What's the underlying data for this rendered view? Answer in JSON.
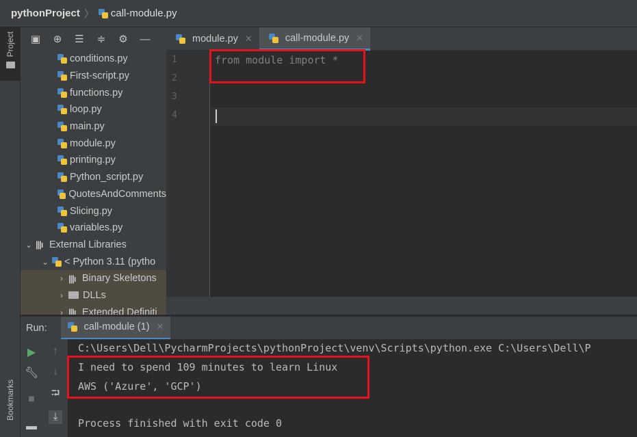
{
  "breadcrumb": {
    "project": "pythonProject",
    "separator": "〉",
    "file": "call-module.py"
  },
  "left_strip": {
    "project_label": "Project",
    "bookmarks_label": "Bookmarks"
  },
  "project_panel": {
    "toolbar_icons": [
      "layout-icon",
      "crosshair-icon",
      "collapse-all-icon",
      "expand-all-icon",
      "gear-icon",
      "minimize-icon"
    ],
    "files": [
      "conditions.py",
      "First-script.py",
      "functions.py",
      "loop.py",
      "main.py",
      "module.py",
      "printing.py",
      "Python_script.py",
      "QuotesAndComments",
      "Slicing.py",
      "variables.py"
    ],
    "external_libraries": "External Libraries",
    "python_sdk": "< Python 3.11 (pytho",
    "binary_skeletons": "Binary Skeletons",
    "dlls": "DLLs",
    "extended_definitions": "Extended Definiti"
  },
  "editor": {
    "tabs": [
      {
        "label": "module.py",
        "active": false
      },
      {
        "label": "call-module.py",
        "active": true
      }
    ],
    "line_numbers": [
      "1",
      "2",
      "3",
      "4"
    ],
    "code_line_1": "from module import *"
  },
  "run": {
    "label": "Run:",
    "tab_label": "call-module (1)",
    "console_command": "C:\\Users\\Dell\\PycharmProjects\\pythonProject\\venv\\Scripts\\python.exe C:\\Users\\Dell\\P",
    "output_line_1": "I need to spend 109 minutes to learn Linux",
    "output_line_2": "AWS ('Azure', 'GCP')",
    "exit_message": "Process finished with exit code 0"
  },
  "colors": {
    "highlight_red": "#e5131d",
    "accent_blue": "#4a88c7",
    "run_green": "#59a869"
  }
}
